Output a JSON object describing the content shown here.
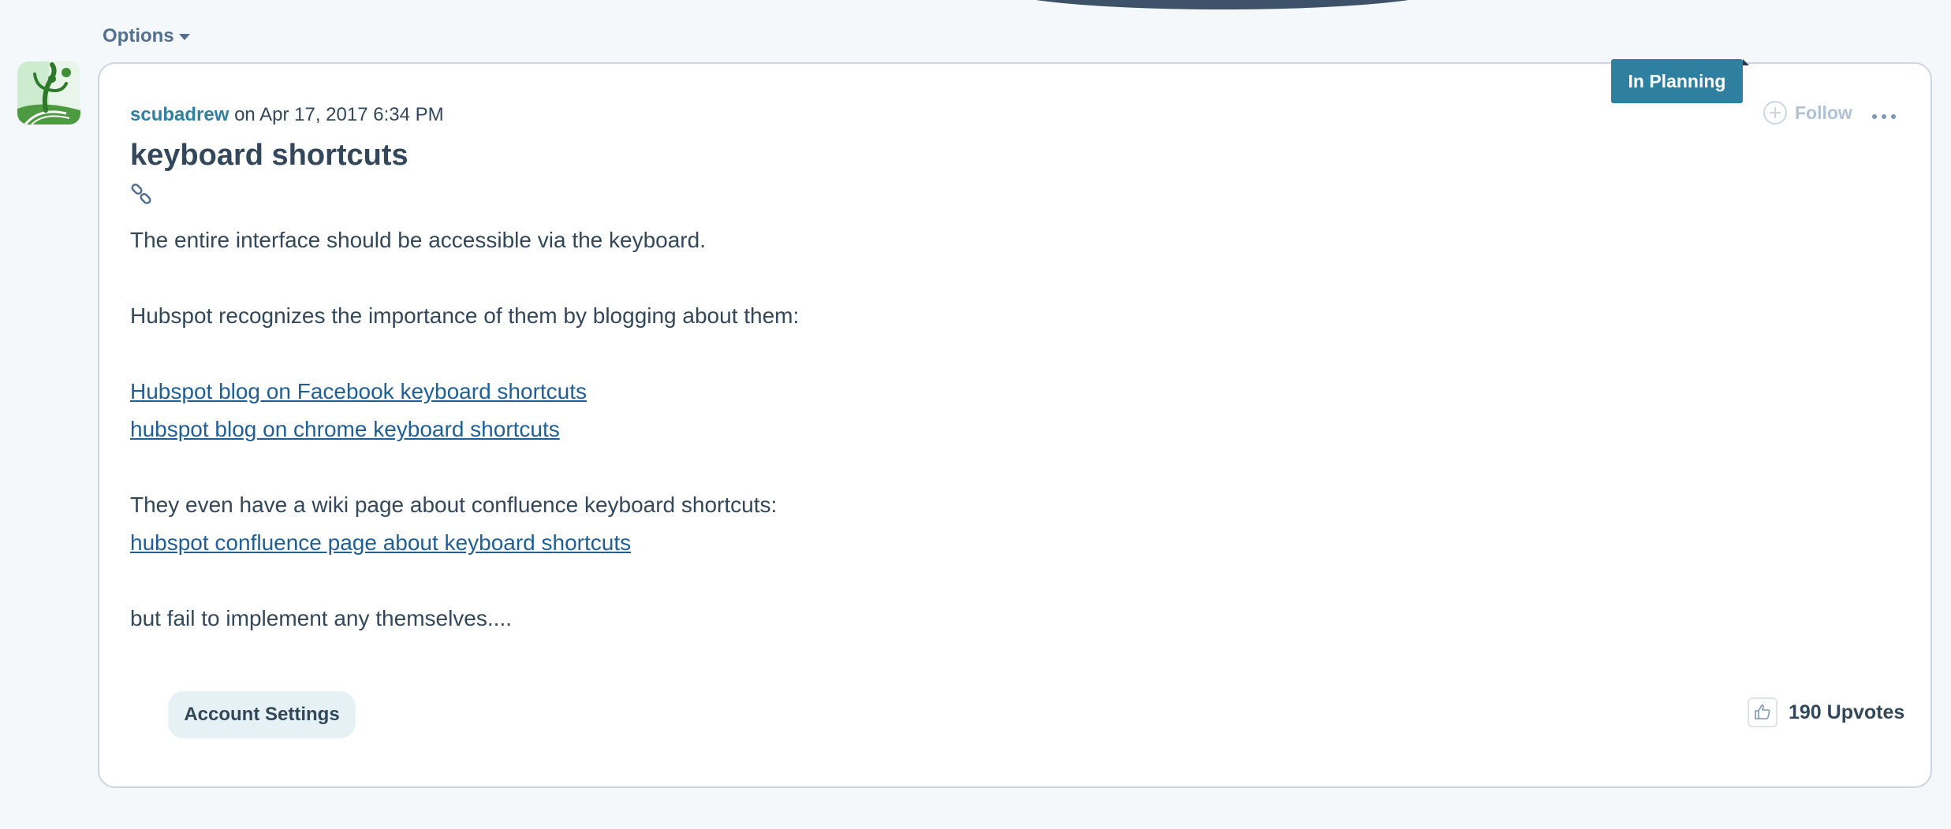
{
  "header": {
    "options_label": "Options"
  },
  "post": {
    "author": "scubadrew",
    "on_word": "on",
    "timestamp": "Apr 17, 2017 6:34 PM",
    "title": "keyboard shortcuts",
    "status": "In Planning",
    "follow_label": "Follow",
    "paragraph_1": "The entire interface should be accessible via the keyboard.",
    "paragraph_2": "Hubspot recognizes the importance of them by blogging about them:",
    "link_1": "Hubspot blog on Facebook keyboard shortcuts",
    "link_2": "hubspot blog on chrome keyboard shortcuts",
    "paragraph_3": "They even have a wiki page about confluence keyboard shortcuts:",
    "link_3": "hubspot confluence page about keyboard shortcuts",
    "paragraph_4": "but fail to implement any themselves....",
    "tag": "Account Settings",
    "upvotes_label": "190 Upvotes"
  },
  "icons": {
    "options_caret": "chevron-down-icon",
    "avatar": "avatar",
    "follow": "plus-circle-icon",
    "more": "more-options-icon",
    "permalink": "link-icon",
    "upvote": "thumbs-up-icon"
  },
  "colors": {
    "accent": "#2f7fa1",
    "link": "#1f5f96",
    "text": "#33475b",
    "badge": "#2f7fa1",
    "page_background": "#f5f8fa",
    "tag_background": "#e5f1f5"
  }
}
